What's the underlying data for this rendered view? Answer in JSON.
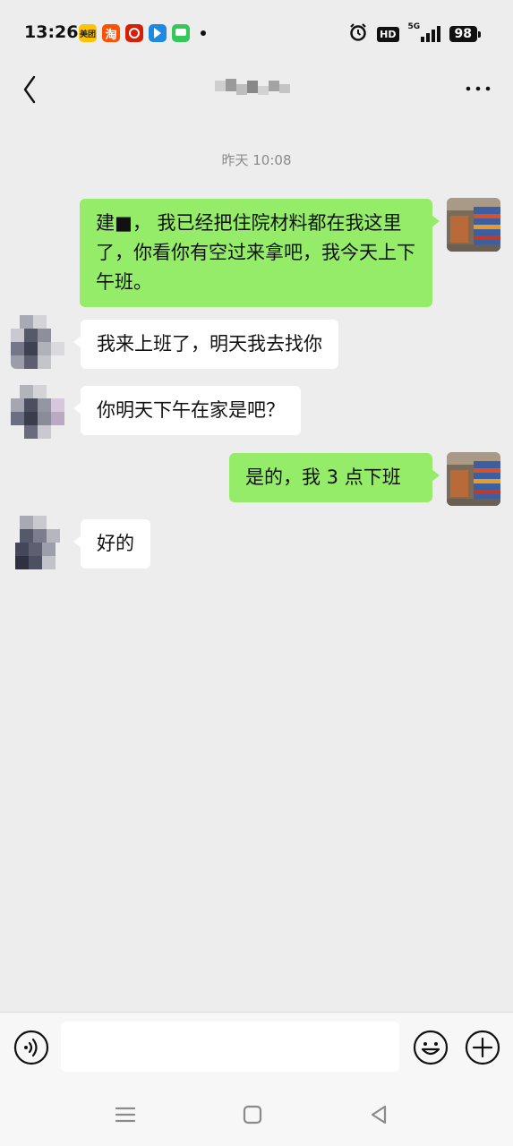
{
  "status_bar": {
    "time": "13:26",
    "app_icons": [
      {
        "name": "meituan-app-icon",
        "label": "美团",
        "color": "#ffc300"
      },
      {
        "name": "taobao-app-icon",
        "label": "淘",
        "color": "#ff5000"
      },
      {
        "name": "red-app-icon",
        "label": "",
        "color": "#d81e06"
      },
      {
        "name": "blue-app-icon",
        "label": "",
        "color": "#1e88e5"
      },
      {
        "name": "green-app-icon",
        "label": "",
        "color": "#34c759"
      }
    ],
    "hd": "HD",
    "network": "5G",
    "battery": "98"
  },
  "chat": {
    "timestamp": "昨天 10:08",
    "messages": [
      {
        "side": "me",
        "text": "建■，  我已经把住院材料都在我这里了，你看你有空过来拿吧，我今天上下午班。"
      },
      {
        "side": "them",
        "text": "我来上班了，明天我去找你"
      },
      {
        "side": "them",
        "text": "你明天下午在家是吧？"
      },
      {
        "side": "me",
        "text": "是的，我 3 点下班"
      },
      {
        "side": "them",
        "text": "好的"
      }
    ]
  },
  "input": {
    "placeholder": ""
  },
  "colors": {
    "background": "#ededed",
    "my_bubble": "#95ec69",
    "their_bubble": "#ffffff"
  }
}
